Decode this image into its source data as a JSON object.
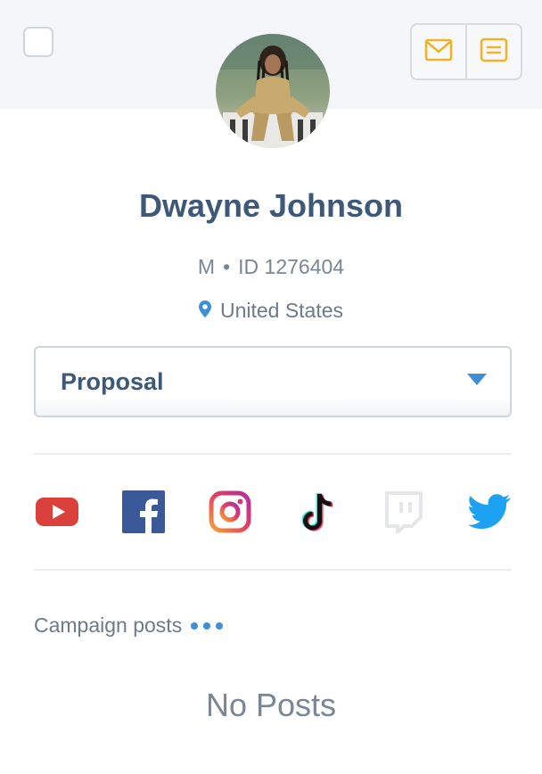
{
  "profile": {
    "name": "Dwayne Johnson",
    "gender": "M",
    "separator": "•",
    "id_label": "ID 1276404",
    "location": "United States"
  },
  "status_select": {
    "value": "Proposal"
  },
  "actions": {
    "icons": [
      "mail-icon",
      "notes-icon"
    ],
    "accent": "#f0b429"
  },
  "social": [
    "youtube-icon",
    "facebook-icon",
    "instagram-icon",
    "tiktok-icon",
    "twitch-icon",
    "twitter-icon"
  ],
  "campaign": {
    "label": "Campaign posts"
  },
  "posts": {
    "empty_text": "No Posts"
  },
  "colors": {
    "heading": "#3d5878",
    "muted": "#7b8694",
    "accent_blue": "#3d8fd6"
  }
}
